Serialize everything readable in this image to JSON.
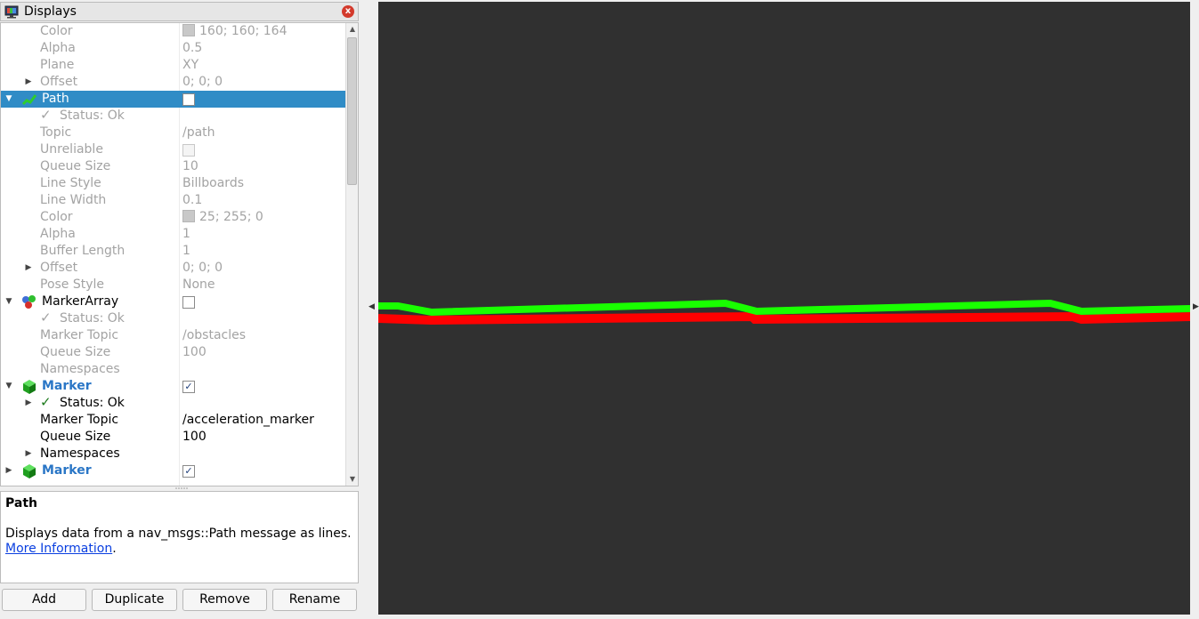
{
  "panel": {
    "title": "Displays",
    "close_icon": "x"
  },
  "tree": {
    "rows": [
      {
        "name": "Color",
        "value": "160; 160; 164"
      },
      {
        "name": "Alpha",
        "value": "0.5"
      },
      {
        "name": "Plane",
        "value": "XY"
      },
      {
        "name": "Offset",
        "value": "0; 0; 0"
      },
      {
        "name": "Path"
      },
      {
        "name": "Status: Ok"
      },
      {
        "name": "Topic",
        "value": "/path"
      },
      {
        "name": "Unreliable"
      },
      {
        "name": "Queue Size",
        "value": "10"
      },
      {
        "name": "Line Style",
        "value": "Billboards"
      },
      {
        "name": "Line Width",
        "value": "0.1"
      },
      {
        "name": "Color",
        "value": "25; 255; 0"
      },
      {
        "name": "Alpha",
        "value": "1"
      },
      {
        "name": "Buffer Length",
        "value": "1"
      },
      {
        "name": "Offset",
        "value": "0; 0; 0"
      },
      {
        "name": "Pose Style",
        "value": "None"
      },
      {
        "name": "MarkerArray"
      },
      {
        "name": "Status: Ok"
      },
      {
        "name": "Marker Topic",
        "value": "/obstacles"
      },
      {
        "name": "Queue Size",
        "value": "100"
      },
      {
        "name": "Namespaces"
      },
      {
        "name": "Marker"
      },
      {
        "name": "Status: Ok"
      },
      {
        "name": "Marker Topic",
        "value": "/acceleration_marker"
      },
      {
        "name": "Queue Size",
        "value": "100"
      },
      {
        "name": "Namespaces"
      },
      {
        "name": "Marker"
      }
    ]
  },
  "description": {
    "title": "Path",
    "text": "Displays data from a nav_msgs::Path message as lines.",
    "link": "More Information",
    "link_suffix": "."
  },
  "buttons": {
    "add": "Add",
    "duplicate": "Duplicate",
    "remove": "Remove",
    "rename": "Rename"
  },
  "viewport": {
    "background": "#303030",
    "path_color": "#19ff00",
    "reference_color": "#ff0000"
  },
  "colors": {
    "selection": "#308cc6",
    "link": "#0a3fe0",
    "display_name": "#2a76c6"
  }
}
